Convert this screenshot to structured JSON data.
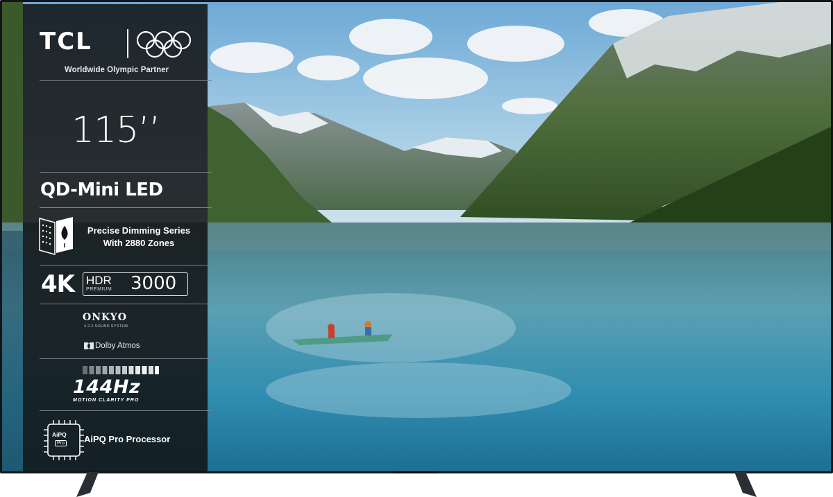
{
  "brand": {
    "logo": "TCL",
    "partner": "Worldwide Olympic Partner",
    "rings_icon": "olympic-rings-icon"
  },
  "product": {
    "size": "115’’",
    "display_tech": "QD-Mini LED",
    "dimming_line1": "Precise Dimming Series",
    "dimming_line2": "With 2880 Zones",
    "resolution": "4K",
    "hdr_label": "HDR",
    "hdr_premium": "PREMIUM",
    "hdr_value": "3000",
    "audio_brand": "ONKYO",
    "audio_sub": "4.2.2 SOUND SYSTEM",
    "dolby": "Dolby Atmos",
    "refresh_rate": "144Hz",
    "refresh_sub": "MOTION CLARITY PRO",
    "chip_label": "AiPQ",
    "chip_sub": "Pro",
    "processor": "AiPQ Pro Processor"
  },
  "colors": {
    "panel_bg": "#121416",
    "frame": "#141518",
    "sky": "#8ec3e3",
    "lake": "#3f8fa8"
  },
  "icons": [
    "olympic-rings-icon",
    "dimming-zones-icon",
    "dolby-icon",
    "refresh-bars-icon",
    "processor-chip-icon"
  ]
}
